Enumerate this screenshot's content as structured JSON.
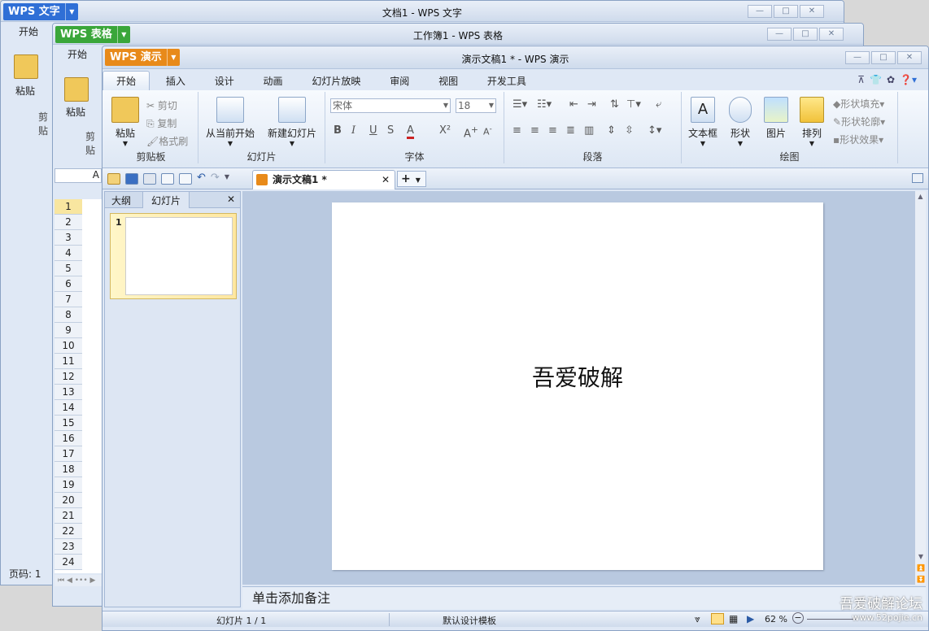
{
  "writer": {
    "app_label": "WPS 文字",
    "title": "文档1 - WPS 文字",
    "menu_start": "开始",
    "paste": "粘贴",
    "clipboard_short": "剪贴",
    "page_status": "页码: 1"
  },
  "sheet": {
    "app_label": "WPS 表格",
    "title": "工作簿1 - WPS 表格",
    "menu_start": "开始",
    "paste": "粘贴",
    "clipboard_short": "剪贴",
    "col_a": "A",
    "rows": [
      "1",
      "2",
      "3",
      "4",
      "5",
      "6",
      "7",
      "8",
      "9",
      "10",
      "11",
      "12",
      "13",
      "14",
      "15",
      "16",
      "17",
      "18",
      "19",
      "20",
      "21",
      "22",
      "23",
      "24"
    ]
  },
  "ppt": {
    "app_label": "WPS 演示",
    "title": "演示文稿1 * - WPS 演示",
    "menu": [
      "开始",
      "插入",
      "设计",
      "动画",
      "幻灯片放映",
      "审阅",
      "视图",
      "开发工具"
    ],
    "ribbon": {
      "paste": "粘贴",
      "cut": "剪切",
      "copy": "复制",
      "format_painter": "格式刷",
      "clipboard": "剪贴板",
      "from_current": "从当前开始",
      "new_slide": "新建幻灯片",
      "slides_group": "幻灯片",
      "font_name": "宋体",
      "font_size": "18",
      "font_group": "字体",
      "paragraph_group": "段落",
      "textbox": "文本框",
      "shape": "形状",
      "picture": "图片",
      "arrange": "排列",
      "shape_fill": "形状填充",
      "shape_outline": "形状轮廓",
      "shape_effect": "形状效果",
      "drawing_group": "绘图"
    },
    "doc_tab": "演示文稿1 *",
    "panel_tabs": {
      "outline": "大纲",
      "slides": "幻灯片"
    },
    "thumb_number": "1",
    "slide_text": "吾爱破解",
    "notes": "单击添加备注",
    "status": {
      "slide": "幻灯片 1 / 1",
      "template": "默认设计模板",
      "zoom": "62 %"
    }
  },
  "watermark": {
    "line1": "吾爱破解论坛",
    "line2": "www.52pojie.cn"
  },
  "colors": {
    "writer": "#2f6fd6",
    "sheet": "#3aa63a",
    "ppt": "#e88a1a"
  }
}
